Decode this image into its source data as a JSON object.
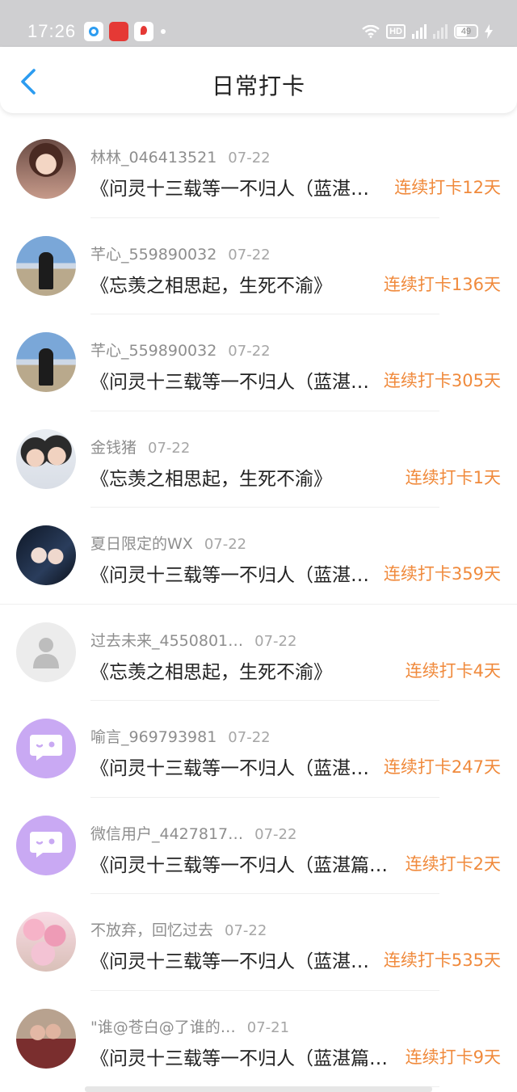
{
  "status_bar": {
    "time": "17:26",
    "hd_label": "HD",
    "battery_level": "49"
  },
  "header": {
    "back_icon": "chevron-left-icon",
    "title": "日常打卡",
    "accent_color": "#2c9cf0"
  },
  "checkins": [
    {
      "user": "林林_046413521",
      "date": "07-22",
      "book": "《问灵十三载等一不归人（蓝湛…",
      "streak": "连续打卡12天",
      "avatar": "photo-woman"
    },
    {
      "user": "芊心_559890032",
      "date": "07-22",
      "book": "《忘羡之相思起，生死不渝》",
      "streak": "连续打卡136天",
      "avatar": "photo-beach"
    },
    {
      "user": "芊心_559890032",
      "date": "07-22",
      "book": "《问灵十三载等一不归人（蓝湛…",
      "streak": "连续打卡305天",
      "avatar": "photo-beach"
    },
    {
      "user": "金钱猪",
      "date": "07-22",
      "book": "《忘羡之相思起，生死不渝》",
      "streak": "连续打卡1天",
      "avatar": "photo-pair"
    },
    {
      "user": "夏日限定的WX",
      "date": "07-22",
      "book": "《问灵十三载等一不归人（蓝湛…",
      "streak": "连续打卡359天",
      "avatar": "photo-anime"
    },
    {
      "user": "过去未来_4550801…",
      "date": "07-22",
      "book": "《忘羡之相思起，生死不渝》",
      "streak": "连续打卡4天",
      "avatar": "default-person"
    },
    {
      "user": "喻言_969793981",
      "date": "07-22",
      "book": "《问灵十三载等一不归人（蓝湛…",
      "streak": "连续打卡247天",
      "avatar": "chat-bubble"
    },
    {
      "user": "微信用户_4427817…",
      "date": "07-22",
      "book": "《问灵十三载等一不归人（蓝湛篇…",
      "streak": "连续打卡2天",
      "avatar": "chat-bubble"
    },
    {
      "user": "不放弃，回忆过去",
      "date": "07-22",
      "book": "《问灵十三载等一不归人（蓝湛…",
      "streak": "连续打卡535天",
      "avatar": "photo-flower"
    },
    {
      "user": "\"谁@苍白@了谁的…",
      "date": "07-21",
      "book": "《问灵十三载等一不归人（蓝湛篇…",
      "streak": "连续打卡9天",
      "avatar": "photo-kids"
    }
  ],
  "colors": {
    "streak": "#f08a3c",
    "username": "#8e8e8e",
    "title": "#222222"
  }
}
